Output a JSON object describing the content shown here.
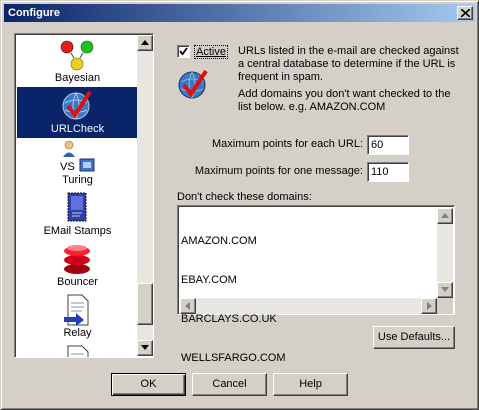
{
  "window": {
    "title": "Configure"
  },
  "sidebar": {
    "items": [
      {
        "label": "Bayesian",
        "icon": "bayesian-icon"
      },
      {
        "label": "URLCheck",
        "icon": "urlcheck-icon",
        "selected": true
      },
      {
        "label": "Turing",
        "icon": "turing-icon",
        "icon_text": "VS"
      },
      {
        "label": "EMail Stamps",
        "icon": "email-stamp-icon"
      },
      {
        "label": "Bouncer",
        "icon": "bouncer-icon"
      },
      {
        "label": "Relay",
        "icon": "relay-icon"
      }
    ]
  },
  "urlcheck": {
    "active_label": "Active",
    "active_checked": true,
    "description_1": "URLs listed in the e-mail are checked against a central database to determine if the URL is frequent in spam.",
    "description_2": "Add domains you don't want checked to the list below.  e.g. AMAZON.COM",
    "max_points_url_label": "Maximum points for each URL:",
    "max_points_url_value": "60",
    "max_points_message_label": "Maximum points for one message:",
    "max_points_message_value": "110",
    "domains_label": "Don't check these domains:",
    "domains": [
      "AMAZON.COM",
      "EBAY.COM",
      "BARCLAYS.CO.UK",
      "WELLSFARGO.COM"
    ],
    "use_defaults_label": "Use Defaults..."
  },
  "buttons": {
    "ok": "OK",
    "cancel": "Cancel",
    "help": "Help"
  },
  "colors": {
    "title_bar": "#0a246a",
    "selection": "#0a246a",
    "face": "#d4d0c8"
  }
}
